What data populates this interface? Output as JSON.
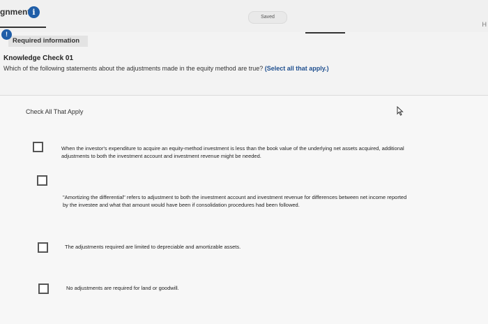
{
  "header": {
    "assignment_title": "gnment",
    "info_icon_glyph": "i",
    "saved_label": "Saved",
    "right_letter": "H"
  },
  "required_info": {
    "badge_glyph": "!",
    "label": "Required information"
  },
  "question": {
    "title": "Knowledge Check 01",
    "prompt": "Which of the following statements about the adjustments made in the equity method are true?",
    "select_note": "(Select all that apply.)"
  },
  "answers": {
    "instruction": "Check All That Apply",
    "options": [
      {
        "line1": "When the investor's expenditure to acquire an equity-method investment is less than the book value of the underlying net assets acquired, additional",
        "line2": "adjustments to both the investment account and investment revenue might be needed.",
        "checked": false
      },
      {
        "line1": "\"Amortizing the differential\" refers to adjustment to both the investment account and investment revenue for differences between net income reported",
        "line2": "by the investee and what that amount would have been if consolidation procedures had been followed.",
        "checked": false
      },
      {
        "line1": "The adjustments required are limited to depreciable and amortizable assets.",
        "line2": "",
        "checked": false
      },
      {
        "line1": "No adjustments are required for land or goodwill.",
        "line2": "",
        "checked": false
      }
    ]
  },
  "colors": {
    "accent_blue": "#1f5ea8",
    "select_note_blue": "#1f4f8f",
    "checkbox_border": "#555555"
  },
  "icons": {
    "info": "info-circle-icon",
    "required": "exclamation-circle-icon",
    "cursor": "mouse-pointer-icon"
  }
}
